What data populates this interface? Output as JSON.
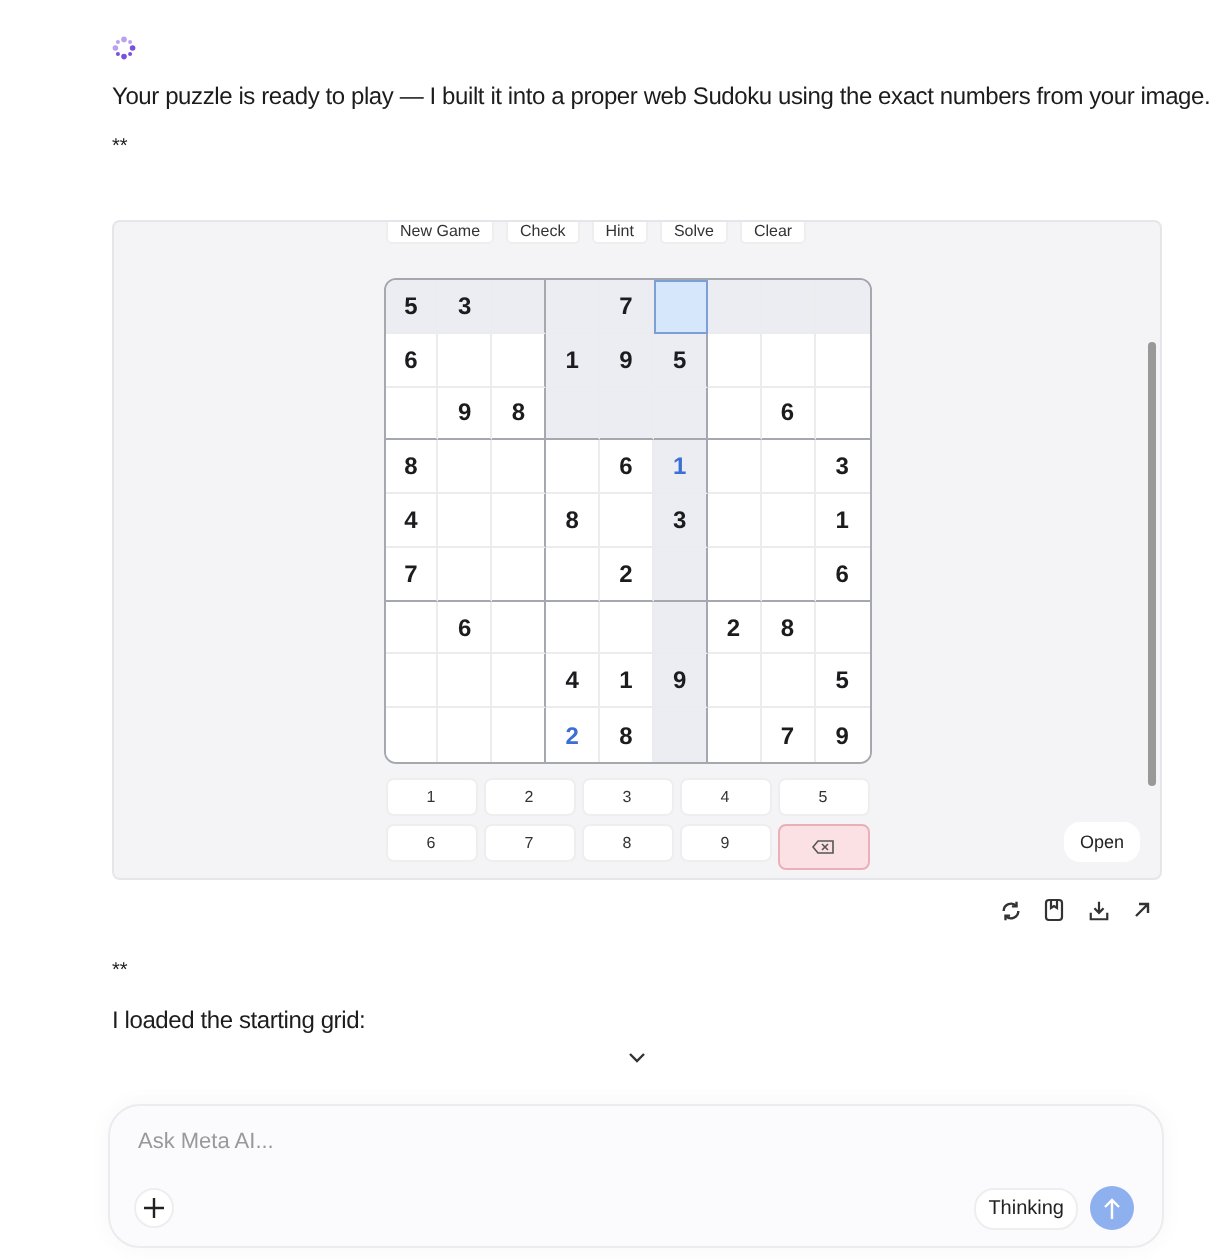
{
  "message": {
    "intro": "Your puzzle is ready to play — I built it into a proper web Sudoku using the exact numbers from your image.",
    "marker_1": "**",
    "marker_2": "**",
    "outro": "I loaded the starting grid:"
  },
  "preview": {
    "toolbar": [
      "New Game",
      "Check",
      "Hint",
      "Solve",
      "Clear"
    ],
    "grid": [
      [
        {
          "value": "5",
          "kind": "given",
          "selected": false
        },
        {
          "value": "3",
          "kind": "given",
          "selected": false
        },
        {
          "selected": false
        },
        {
          "selected": false
        },
        {
          "value": "7",
          "kind": "given",
          "selected": false
        },
        {
          "selected": true
        },
        {
          "selected": false
        },
        {
          "selected": false
        },
        {
          "selected": false
        }
      ],
      [
        {
          "value": "6",
          "kind": "given",
          "selected": false
        },
        {
          "selected": false
        },
        {
          "selected": false
        },
        {
          "value": "1",
          "kind": "given",
          "selected": false
        },
        {
          "value": "9",
          "kind": "given",
          "selected": false
        },
        {
          "value": "5",
          "kind": "given",
          "selected": false
        },
        {
          "selected": false
        },
        {
          "selected": false
        },
        {
          "selected": false
        }
      ],
      [
        {
          "selected": false
        },
        {
          "value": "9",
          "kind": "given",
          "selected": false
        },
        {
          "value": "8",
          "kind": "given",
          "selected": false
        },
        {
          "selected": false
        },
        {
          "selected": false
        },
        {
          "selected": false
        },
        {
          "selected": false
        },
        {
          "value": "6",
          "kind": "given",
          "selected": false
        },
        {
          "selected": false
        }
      ],
      [
        {
          "value": "8",
          "kind": "given",
          "selected": false
        },
        {
          "selected": false
        },
        {
          "selected": false
        },
        {
          "selected": false
        },
        {
          "value": "6",
          "kind": "given",
          "selected": false
        },
        {
          "value": "1",
          "kind": "entered",
          "selected": false
        },
        {
          "selected": false
        },
        {
          "selected": false
        },
        {
          "value": "3",
          "kind": "given",
          "selected": false
        }
      ],
      [
        {
          "value": "4",
          "kind": "given",
          "selected": false
        },
        {
          "selected": false
        },
        {
          "selected": false
        },
        {
          "value": "8",
          "kind": "given",
          "selected": false
        },
        {
          "selected": false
        },
        {
          "value": "3",
          "kind": "given",
          "selected": false
        },
        {
          "selected": false
        },
        {
          "selected": false
        },
        {
          "value": "1",
          "kind": "given",
          "selected": false
        }
      ],
      [
        {
          "value": "7",
          "kind": "given",
          "selected": false
        },
        {
          "selected": false
        },
        {
          "selected": false
        },
        {
          "selected": false
        },
        {
          "value": "2",
          "kind": "given",
          "selected": false
        },
        {
          "selected": false
        },
        {
          "selected": false
        },
        {
          "selected": false
        },
        {
          "value": "6",
          "kind": "given",
          "selected": false
        }
      ],
      [
        {
          "selected": false
        },
        {
          "value": "6",
          "kind": "given",
          "selected": false
        },
        {
          "selected": false
        },
        {
          "selected": false
        },
        {
          "selected": false
        },
        {
          "selected": false
        },
        {
          "value": "2",
          "kind": "given",
          "selected": false
        },
        {
          "value": "8",
          "kind": "given",
          "selected": false
        },
        {
          "selected": false
        }
      ],
      [
        {
          "selected": false
        },
        {
          "selected": false
        },
        {
          "selected": false
        },
        {
          "value": "4",
          "kind": "given",
          "selected": false
        },
        {
          "value": "1",
          "kind": "given",
          "selected": false
        },
        {
          "value": "9",
          "kind": "given",
          "selected": false
        },
        {
          "selected": false
        },
        {
          "selected": false
        },
        {
          "value": "5",
          "kind": "given",
          "selected": false
        }
      ],
      [
        {
          "selected": false
        },
        {
          "selected": false
        },
        {
          "selected": false
        },
        {
          "value": "2",
          "kind": "entered",
          "selected": false
        },
        {
          "value": "8",
          "kind": "given",
          "selected": false
        },
        {
          "selected": false
        },
        {
          "selected": false
        },
        {
          "value": "7",
          "kind": "given",
          "selected": false
        },
        {
          "value": "9",
          "kind": "given",
          "selected": false
        }
      ]
    ],
    "keypad": [
      "1",
      "2",
      "3",
      "4",
      "5",
      "6",
      "7",
      "8",
      "9"
    ],
    "open_button": "Open"
  },
  "composer": {
    "placeholder": "Ask Meta AI...",
    "mode_button": "Thinking"
  }
}
